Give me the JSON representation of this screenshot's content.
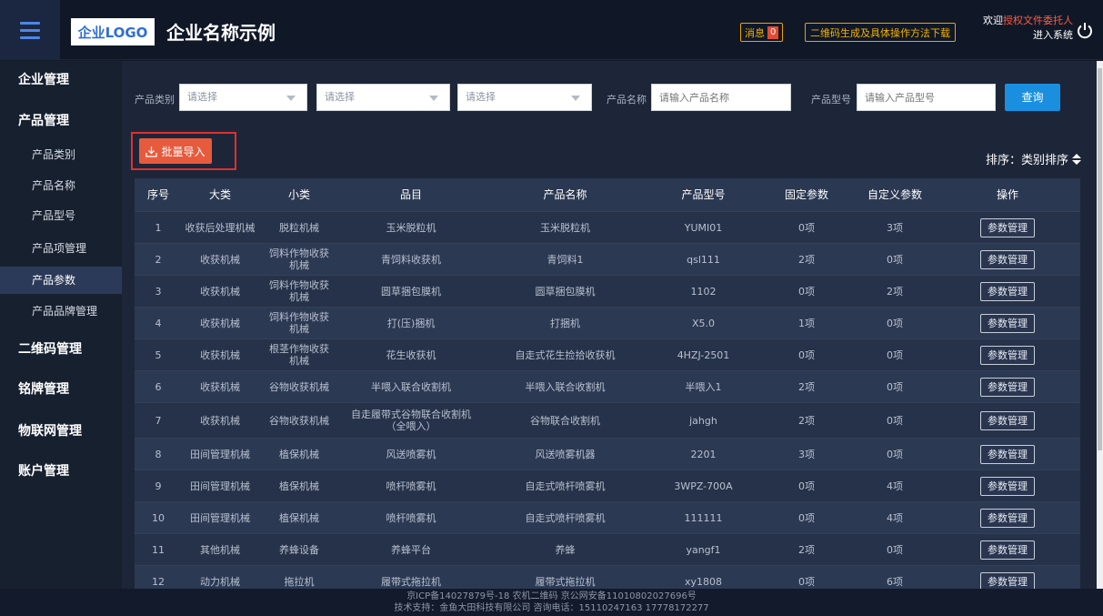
{
  "header": {
    "logo": "企业LOGO",
    "company_name": "企业名称示例",
    "message_label": "消息",
    "message_count": "0",
    "qr_label": "二维码生成及具体操作方法下载",
    "welcome_prefix": "欢迎",
    "welcome_user": "授权文件委托人",
    "welcome_line2": "进入系统",
    "icons": [
      "menu-icon",
      "power-icon"
    ]
  },
  "sidebar": {
    "groups": [
      {
        "label": "企业管理"
      },
      {
        "label": "产品管理"
      },
      {
        "label": "二维码管理"
      },
      {
        "label": "铭牌管理"
      },
      {
        "label": "物联网管理"
      },
      {
        "label": "账户管理"
      }
    ],
    "product_items": [
      "产品类别",
      "产品名称",
      "产品型号",
      "产品项管理",
      "产品参数",
      "产品品牌管理"
    ],
    "active_item": "产品参数"
  },
  "filters": {
    "category_label": "产品类别",
    "select1_placeholder": "请选择",
    "select2_placeholder": "请选择",
    "select3_placeholder": "请选择",
    "name_label": "产品名称",
    "name_placeholder": "请输入产品名称",
    "model_label": "产品型号",
    "model_placeholder": "请输入产品型号",
    "query_label": "查询"
  },
  "import_label": "批量导入",
  "sort_label": "排序：类别排序",
  "table": {
    "headers": [
      "序号",
      "大类",
      "小类",
      "品目",
      "产品名称",
      "产品型号",
      "固定参数",
      "自定义参数",
      "操作"
    ],
    "action_label": "参数管理",
    "rows": [
      [
        "1",
        "收获后处理机械",
        "脱粒机械",
        "玉米脱粒机",
        "玉米脱粒机",
        "YUMI01",
        "0项",
        "3项"
      ],
      [
        "2",
        "收获机械",
        "饲料作物收获机械",
        "青饲料收获机",
        "青饲料1",
        "qsl111",
        "2项",
        "0项"
      ],
      [
        "3",
        "收获机械",
        "饲料作物收获机械",
        "圆草捆包膜机",
        "圆草捆包膜机",
        "1102",
        "0项",
        "2项"
      ],
      [
        "4",
        "收获机械",
        "饲料作物收获机械",
        "打(压)捆机",
        "打捆机",
        "X5.0",
        "1项",
        "0项"
      ],
      [
        "5",
        "收获机械",
        "根茎作物收获机械",
        "花生收获机",
        "自走式花生捡拾收获机",
        "4HZJ-2501",
        "0项",
        "0项"
      ],
      [
        "6",
        "收获机械",
        "谷物收获机械",
        "半喂入联合收割机",
        "半喂入联合收割机",
        "半喂入1",
        "2项",
        "0项"
      ],
      [
        "7",
        "收获机械",
        "谷物收获机械",
        "自走履带式谷物联合收割机（全喂入）",
        "谷物联合收割机",
        "jahgh",
        "2项",
        "0项"
      ],
      [
        "8",
        "田间管理机械",
        "植保机械",
        "风送喷雾机",
        "风送喷雾机器",
        "2201",
        "3项",
        "0项"
      ],
      [
        "9",
        "田间管理机械",
        "植保机械",
        "喷杆喷雾机",
        "自走式喷杆喷雾机",
        "3WPZ-700A",
        "0项",
        "4项"
      ],
      [
        "10",
        "田间管理机械",
        "植保机械",
        "喷杆喷雾机",
        "自走式喷杆喷雾机",
        "111111",
        "0项",
        "4项"
      ],
      [
        "11",
        "其他机械",
        "养蜂设备",
        "养蜂平台",
        "养蜂",
        "yangf1",
        "2项",
        "0项"
      ],
      [
        "12",
        "动力机械",
        "拖拉机",
        "履带式拖拉机",
        "履带式拖拉机",
        "xy1808",
        "0项",
        "6项"
      ]
    ]
  },
  "footer": {
    "line1": "京ICP备14027879号-18 农机二维码 京公网安备11010802027696号",
    "line2": "技术支持：金鱼大田科技有限公司    咨询电话：15110247163  17778172277"
  }
}
